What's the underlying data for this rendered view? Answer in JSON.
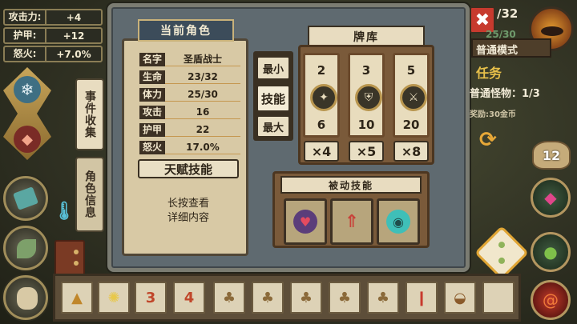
{
  "top_stats": [
    {
      "label": "攻击力:",
      "value": "+4"
    },
    {
      "label": "护甲:",
      "value": "+12"
    },
    {
      "label": "怒火:",
      "value": "+7.0%"
    }
  ],
  "side_tabs": {
    "event_collection": "事件收集",
    "character_info": "角色信息"
  },
  "character_panel": {
    "title": "当前角色",
    "rows": [
      {
        "key": "名字",
        "value": "圣盾战士"
      },
      {
        "key": "生命",
        "value": "23/32"
      },
      {
        "key": "体力",
        "value": "25/30"
      },
      {
        "key": "攻击",
        "value": "16"
      },
      {
        "key": "护甲",
        "value": "22"
      },
      {
        "key": "怒火",
        "value": "17.0%"
      }
    ],
    "talent_button": "天赋技能",
    "hint": "长按查看\n详细内容"
  },
  "deck": {
    "title": "牌库",
    "sort_buttons": [
      "最小",
      "技能",
      "最大"
    ],
    "cards": [
      {
        "top": "2",
        "bottom": "6",
        "count": "×4",
        "icon": "sword-shield-icon"
      },
      {
        "top": "3",
        "bottom": "10",
        "count": "×5",
        "icon": "twin-shield-icon"
      },
      {
        "top": "5",
        "bottom": "20",
        "count": "×8",
        "icon": "crossed-swords-icon"
      }
    ]
  },
  "passive": {
    "title": "被动技能",
    "skills": [
      "heart-rune-icon",
      "arrow-tree-icon",
      "spirit-orb-icon"
    ]
  },
  "hud": {
    "hp_text": "/32",
    "stamina_text": "25/30",
    "mode": "普通模式",
    "quest_title": "任务",
    "quest_progress": "普通怪物：1/3",
    "reward": "奖励:30金币",
    "bag_count": "12"
  },
  "bottom_slots": [
    "triangle-rune-icon",
    "lightbulb-icon",
    "3",
    "4",
    "mushroom-icon",
    "mushroom-icon",
    "mushroom-icon",
    "mushroom-icon",
    "mushroom-icon",
    "potion-vial-icon",
    "burger-icon",
    "empty"
  ],
  "colors": {
    "accent": "#c59750",
    "frame": "#5f6a70",
    "panel": "#d8c9a5",
    "dark": "#3d3124"
  }
}
